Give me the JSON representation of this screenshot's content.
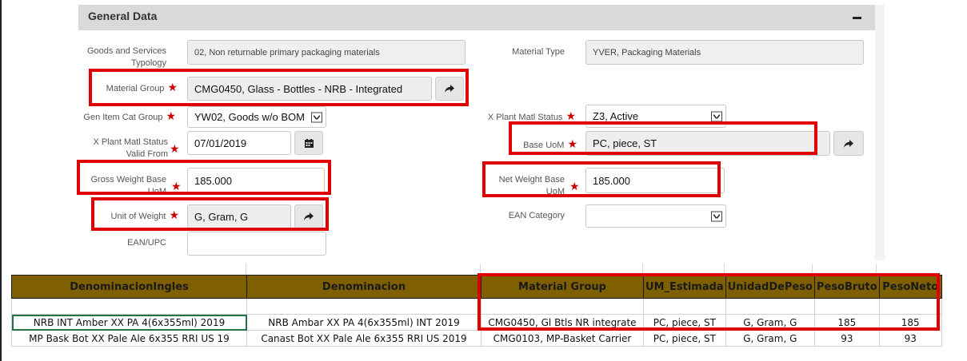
{
  "panel": {
    "title": "General Data"
  },
  "form": {
    "goods_typology": {
      "label": "Goods and Services Typology",
      "value": "02, Non returnable primary packaging materials"
    },
    "material_type": {
      "label": "Material Type",
      "value": "YVER, Packaging Materials"
    },
    "material_group": {
      "label": "Material Group",
      "value": "CMG0450, Glass - Bottles - NRB - Integrated"
    },
    "gen_item_cat_group": {
      "label": "Gen Item Cat Group",
      "value": "YW02, Goods w/o BOM"
    },
    "x_plant_matl_status": {
      "label": "X Plant Matl Status",
      "value": "Z3, Active"
    },
    "x_plant_valid_from": {
      "label_line1": "X Plant Matl Status",
      "label_line2": "Valid From",
      "value": "07/01/2019"
    },
    "base_uom": {
      "label": "Base UoM",
      "value": "PC, piece, ST"
    },
    "gross_weight": {
      "label_line1": "Gross Weight Base",
      "label_line2": "UoM",
      "value": "185.000"
    },
    "net_weight": {
      "label_line1": "Net Weight Base",
      "label_line2": "UoM",
      "value": "185.000"
    },
    "unit_of_weight": {
      "label": "Unit of Weight",
      "value": "G, Gram, G"
    },
    "ean_category": {
      "label": "EAN Category",
      "value": ""
    },
    "ean_upc": {
      "label": "EAN/UPC",
      "value": ""
    }
  },
  "sheet": {
    "headers": [
      "DenominacionIngles",
      "Denominacion",
      "Material Group",
      "UM_Estimada",
      "UnidadDePeso",
      "PesoBruto",
      "PesoNeto"
    ],
    "rows": [
      [
        "NRB INT Amber XX PA 4(6x355ml) 2019",
        "NRB Ambar XX PA 4(6x355ml) INT 2019",
        "CMG0450, Gl Btls NR integrate",
        "PC, piece, ST",
        "G, Gram, G",
        "185",
        "185"
      ],
      [
        "MP Bask Bot XX Pale Ale 6x355 RRI US 19",
        "Canast Bot XX Pale Ale 6x355 RRI US 2019",
        "CMG0103, MP-Basket Carrier",
        "PC, piece, ST",
        "G, Gram, G",
        "93",
        "93"
      ]
    ]
  },
  "icons": {
    "required": "asterisk-icon",
    "forward": "share-arrow-icon",
    "calendar": "calendar-icon",
    "dropdown": "chevron-down-icon",
    "collapse": "minus-icon"
  },
  "colors": {
    "header_bg": "#7f6000",
    "highlight": "#e00000",
    "required": "#cc0000"
  }
}
